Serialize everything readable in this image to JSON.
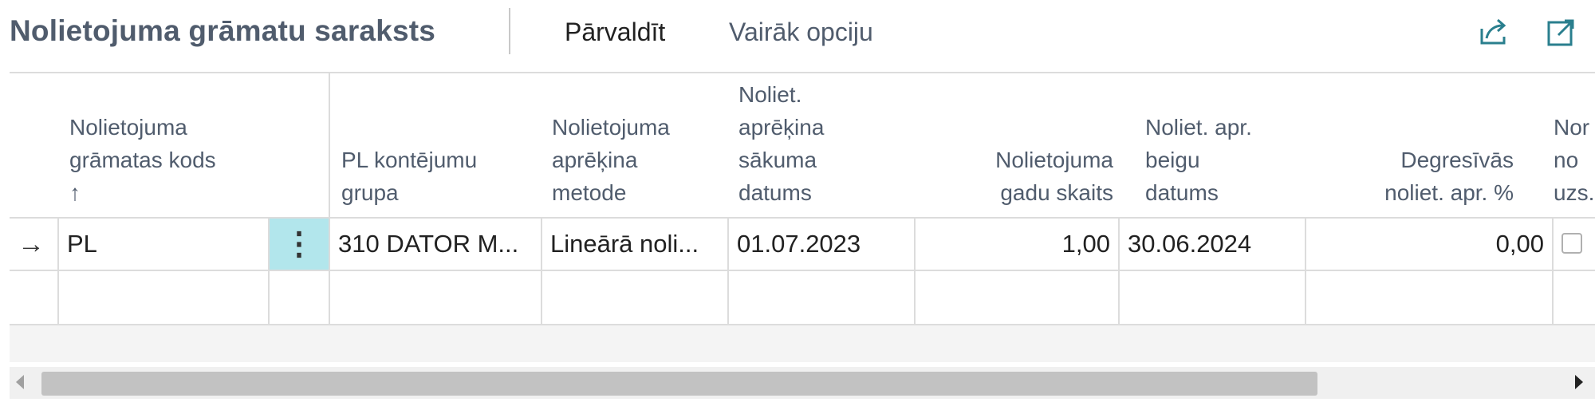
{
  "header": {
    "title": "Nolietojuma grāmatu saraksts",
    "actions": {
      "manage": "Pārvaldīt",
      "more_options": "Vairāk opciju"
    }
  },
  "table": {
    "columns": {
      "book_code": "Nolietojuma\ngrāmatas kods\n↑",
      "posting_group": "PL kontējumu\ngrupa",
      "method": "Nolietojuma\naprēķina\nmetode",
      "start_date": "Noliet.\naprēķina\nsākuma\ndatums",
      "years": "Nolietojuma\ngadu skaits",
      "end_date": "Noliet. apr.\nbeigu\ndatums",
      "declining_pct": "Degresīvās\nnoliet. apr. %",
      "partial": "Nor\nno\nuzs."
    },
    "rows": [
      {
        "book_code": "PL",
        "posting_group": "310 DATOR M...",
        "method": "Lineārā noli...",
        "start_date": "01.07.2023",
        "years": "1,00",
        "end_date": "30.06.2024",
        "declining_pct": "0,00"
      }
    ]
  },
  "icons": {
    "row_arrow": "arrow-right-icon",
    "share": "share-icon",
    "expand": "expand-icon"
  },
  "colors": {
    "accent": "#2a7f8e",
    "selected_cell": "#b2e6ec",
    "title": "#505c6d"
  }
}
